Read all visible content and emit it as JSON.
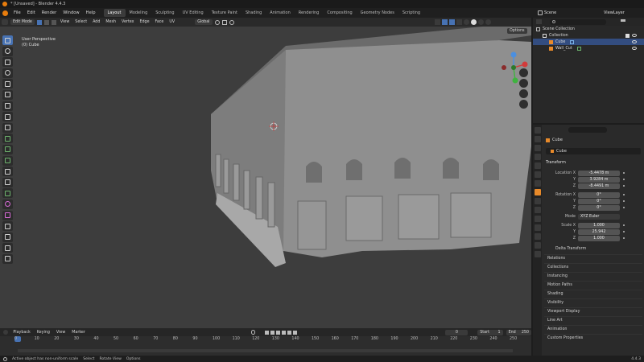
{
  "title_bar": {
    "title": "* [Unsaved] - Blender 4.4.3"
  },
  "menu": {
    "items": [
      "File",
      "Edit",
      "Render",
      "Window",
      "Help"
    ]
  },
  "workspaces": [
    "Layout",
    "Modeling",
    "Sculpting",
    "UV Editing",
    "Texture Paint",
    "Shading",
    "Animation",
    "Rendering",
    "Compositing",
    "Geometry Nodes",
    "Scripting"
  ],
  "workspace_active": "Layout",
  "scene": {
    "name": "Scene",
    "view_layer": "ViewLayer"
  },
  "viewport_header": {
    "mode": "Edit Mode",
    "menus": [
      "View",
      "Select",
      "Add",
      "Mesh",
      "Vertex",
      "Edge",
      "Face",
      "UV"
    ],
    "orientation": "Global",
    "options_label": "Options"
  },
  "viewport_overlay": {
    "line1": "User Perspective",
    "line2": "(0) Cube"
  },
  "timeline": {
    "menus": [
      "Playback",
      "Keying",
      "View",
      "Marker"
    ],
    "current_frame": "0",
    "start_label": "Start",
    "start": "1",
    "end_label": "End",
    "end": "250",
    "ruler": [
      "0",
      "10",
      "20",
      "30",
      "40",
      "50",
      "60",
      "70",
      "80",
      "90",
      "100",
      "110",
      "120",
      "130",
      "140",
      "150",
      "160",
      "170",
      "180",
      "190",
      "200",
      "210",
      "220",
      "230",
      "240",
      "250"
    ]
  },
  "status_bar": {
    "message": "Active object has non-uniform scale",
    "select": "Select",
    "rotate": "Rotate View",
    "options": "Options",
    "version": "4.4.3"
  },
  "outliner": {
    "search_placeholder": "",
    "root": "Scene Collection",
    "items": [
      {
        "name": "Collection",
        "level": 1
      },
      {
        "name": "Cube",
        "level": 2,
        "selected": true
      },
      {
        "name": "Wall_Cut",
        "level": 2
      }
    ]
  },
  "properties": {
    "search_placeholder": "",
    "object_name": "Cube",
    "object_field": "Cube",
    "transform_title": "Transform",
    "location": {
      "label": "Location X",
      "x": "-5.4478 m",
      "y": "3.9284 m",
      "z": "-8.4491 m"
    },
    "rotation": {
      "label": "Rotation X",
      "x": "0°",
      "y": "0°",
      "z": "0°"
    },
    "mode": {
      "label": "Mode",
      "value": "XYZ Euler"
    },
    "scale": {
      "label": "Scale X",
      "x": "1.000",
      "y": "25.942",
      "z": "1.000"
    },
    "axis_y": "Y",
    "axis_z": "Z",
    "panels": [
      "Delta Transform",
      "Relations",
      "Collections",
      "Instancing",
      "Motion Paths",
      "Shading",
      "Visibility",
      "Viewport Display",
      "Line Art",
      "Animation",
      "Custom Properties"
    ]
  },
  "colors": {
    "accent": "#4772b3",
    "selected_row": "#334d80",
    "viewport_bg": "#3d3d3d",
    "mesh": "#8f8f8f"
  }
}
